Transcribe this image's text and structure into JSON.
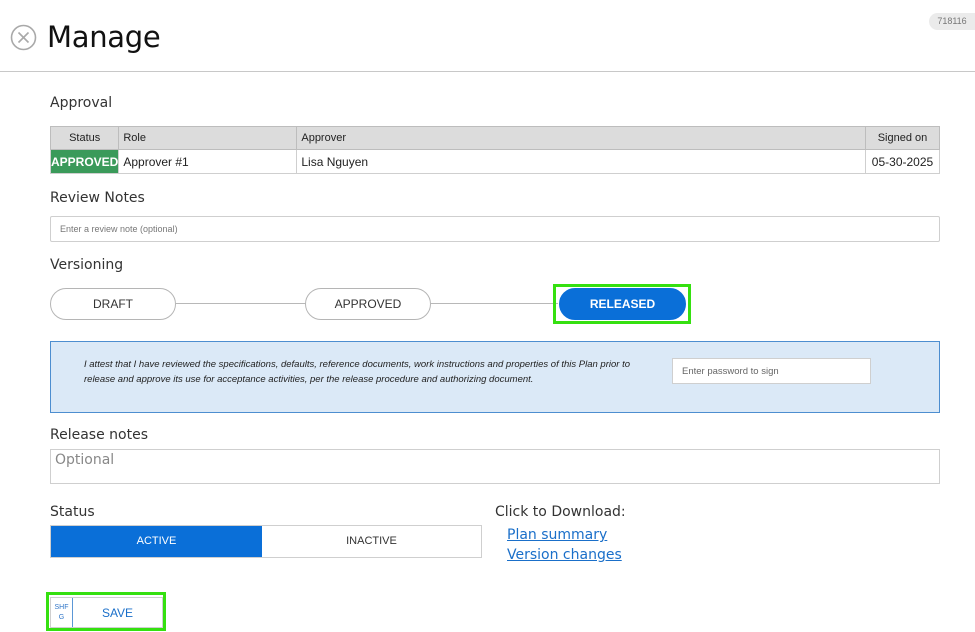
{
  "header": {
    "title": "Manage",
    "record_id": "718116",
    "close_icon": "close-circle-icon"
  },
  "approval": {
    "label": "Approval",
    "columns": {
      "status": "Status",
      "role": "Role",
      "approver": "Approver",
      "signed_on": "Signed on"
    },
    "rows": [
      {
        "status": "APPROVED",
        "role": "Approver #1",
        "approver": "Lisa Nguyen",
        "signed_on": "05-30-2025"
      }
    ],
    "approved_color": "#3a9a5a"
  },
  "review_notes": {
    "label": "Review Notes",
    "placeholder": "Enter a review note (optional)",
    "value": ""
  },
  "versioning": {
    "label": "Versioning",
    "steps": [
      "DRAFT",
      "APPROVED",
      "RELEASED"
    ],
    "active_step": "RELEASED",
    "active_color": "#0a6fd8"
  },
  "attestation": {
    "text": "I attest that I have reviewed the specifications, defaults, reference documents, work instructions and properties of this Plan prior to release and approve its use for acceptance activities, per the release procedure and authorizing document.",
    "password_placeholder": "Enter password to sign"
  },
  "release_notes": {
    "label": "Release notes",
    "placeholder": "Optional",
    "value": ""
  },
  "status": {
    "label": "Status",
    "options": [
      "ACTIVE",
      "INACTIVE"
    ],
    "selected": "ACTIVE"
  },
  "download": {
    "label": "Click to Download:",
    "links": [
      "Plan summary",
      "Version changes"
    ]
  },
  "save": {
    "shortcut": "SHFG",
    "shortcut_line1": "SHF",
    "shortcut_line2": "G",
    "label": "SAVE"
  },
  "highlight_color": "#35e010"
}
